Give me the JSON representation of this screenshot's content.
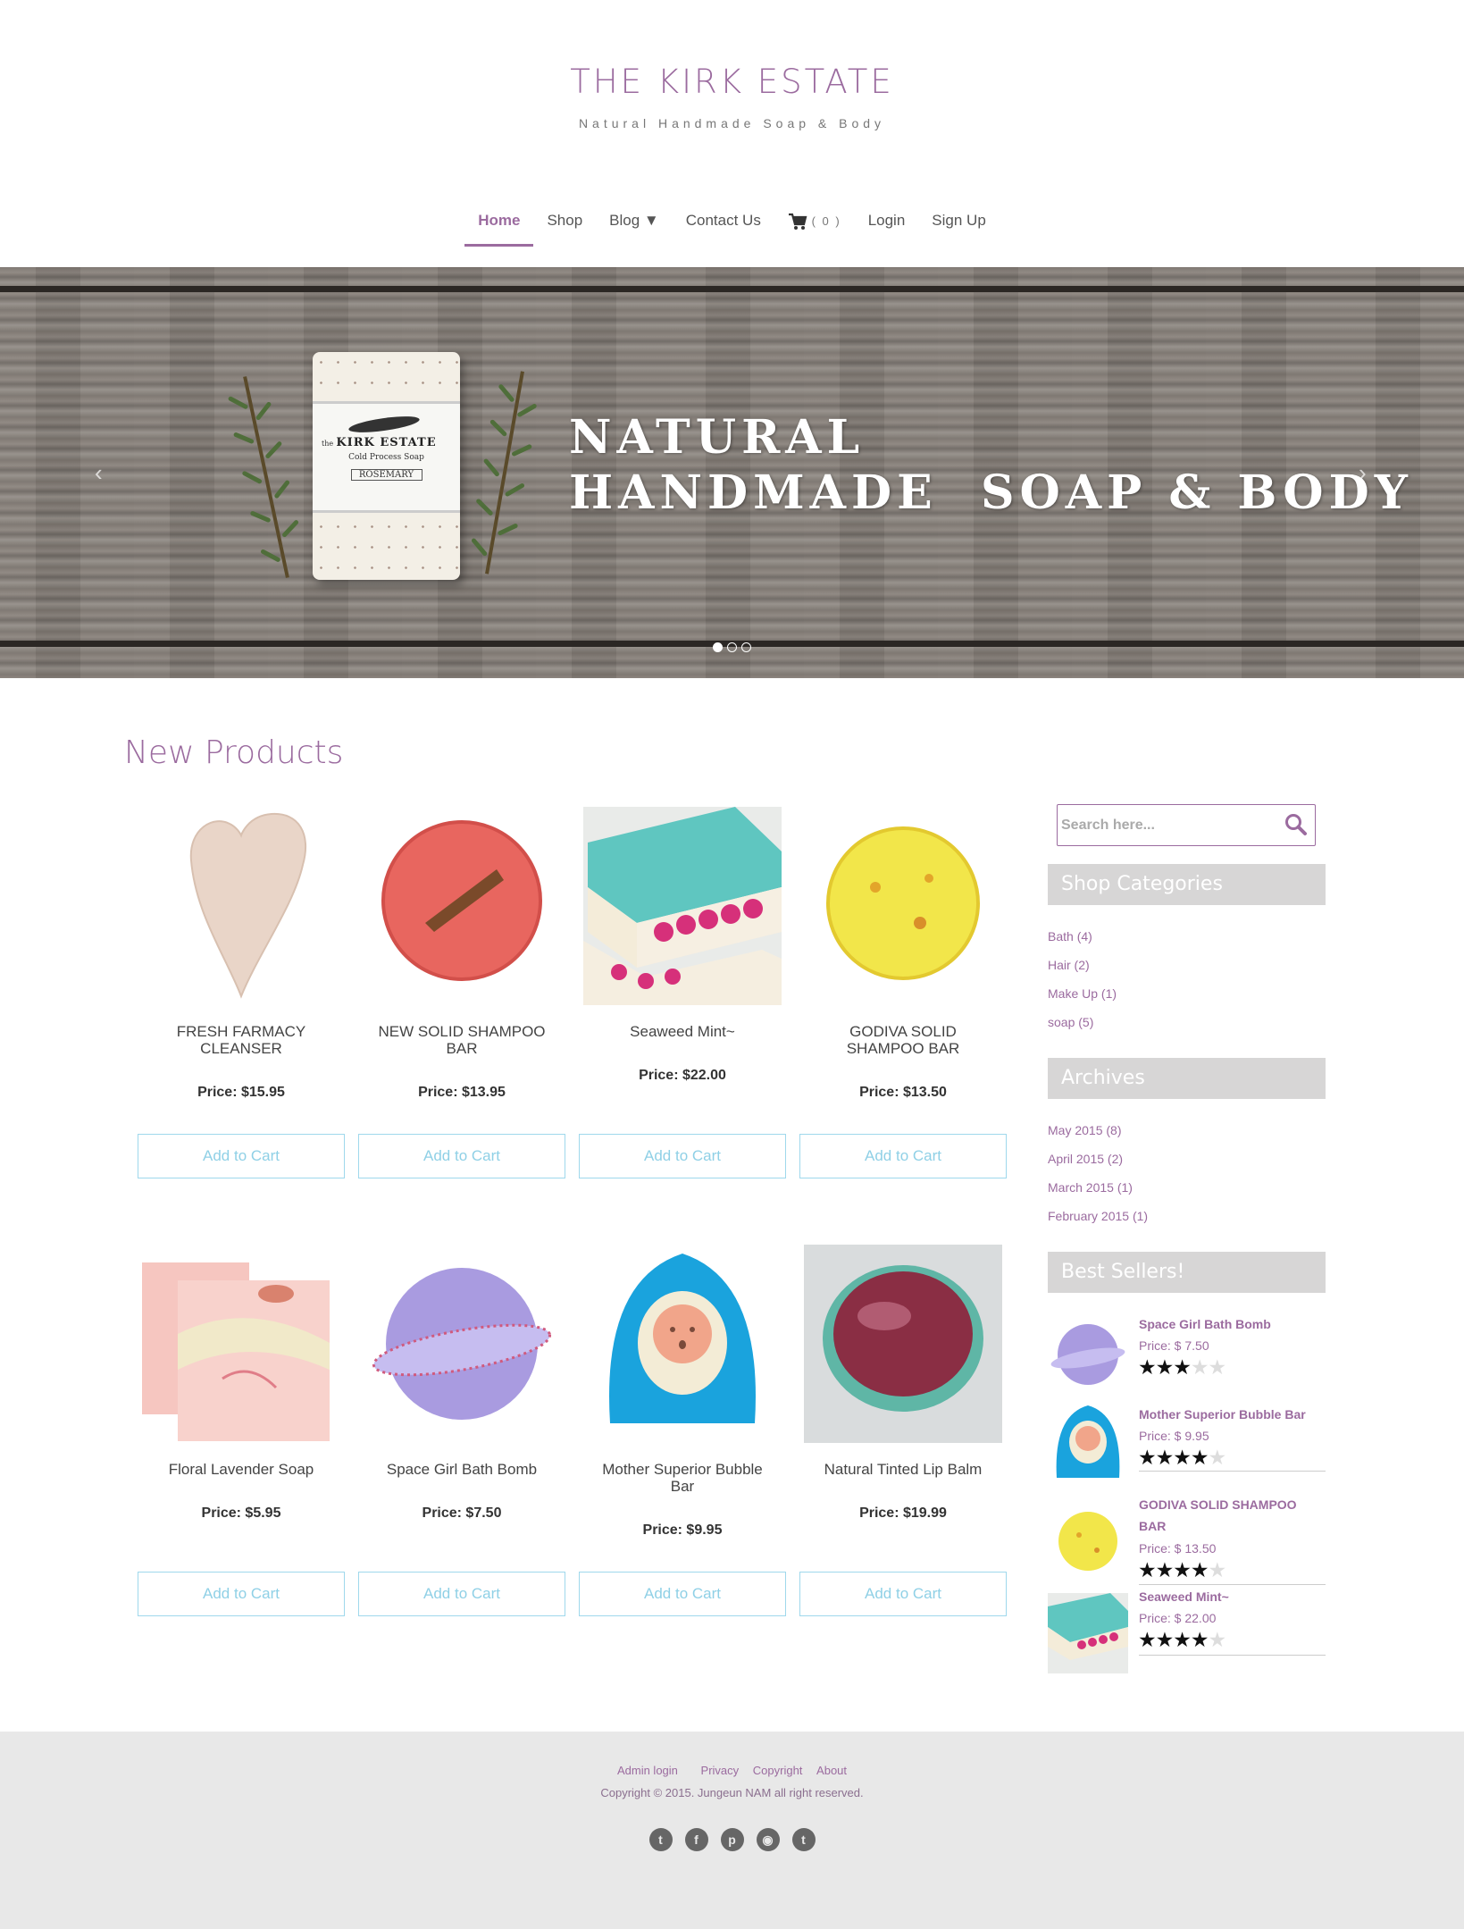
{
  "header": {
    "title": "THE KIRK ESTATE",
    "tagline": "Natural Handmade Soap & Body"
  },
  "nav": {
    "items": [
      {
        "label": "Home",
        "active": true
      },
      {
        "label": "Shop"
      },
      {
        "label": "Blog ▼"
      },
      {
        "label": "Contact Us"
      },
      {
        "label": "( 0 )",
        "icon": "cart-icon"
      },
      {
        "label": "Login"
      },
      {
        "label": "Sign Up"
      }
    ]
  },
  "hero": {
    "line1": "NATURAL",
    "line2": "HANDMADE  SOAP & BODY",
    "soap_brand": "KIRK ESTATE",
    "soap_small": "the",
    "soap_sub": "Cold Process Soap",
    "soap_name": "ROSEMARY",
    "prev_icon": "chevron-left-icon",
    "next_icon": "chevron-right-icon",
    "active_slide": 1,
    "slide_count": 3
  },
  "products_section": {
    "title": "New Products",
    "add_label": "Add to Cart",
    "items": [
      {
        "name": "FRESH FARMACY CLEANSER",
        "price": "Price: $15.95"
      },
      {
        "name": "NEW SOLID SHAMPOO BAR",
        "price": "Price: $13.95"
      },
      {
        "name": "Seaweed Mint~",
        "price": "Price: $22.00"
      },
      {
        "name": "GODIVA SOLID SHAMPOO BAR",
        "price": "Price: $13.50"
      },
      {
        "name": "Floral Lavender Soap",
        "price": "Price: $5.95"
      },
      {
        "name": "Space Girl Bath Bomb",
        "price": "Price: $7.50"
      },
      {
        "name": "Mother Superior Bubble Bar",
        "price": "Price: $9.95"
      },
      {
        "name": "Natural Tinted Lip Balm",
        "price": "Price: $19.99"
      }
    ]
  },
  "sidebar": {
    "search_placeholder": "Search here...",
    "categories_title": "Shop Categories",
    "categories": [
      "Bath (4)",
      "Hair (2)",
      "Make Up (1)",
      "soap (5)"
    ],
    "archives_title": "Archives",
    "archives": [
      "May 2015 (8)",
      "April 2015 (2)",
      "March 2015 (1)",
      "February 2015 (1)"
    ],
    "bestsellers_title": "Best Sellers!",
    "bestsellers": [
      {
        "name": "Space Girl Bath Bomb",
        "price": "Price: $ 7.50",
        "rating": 3
      },
      {
        "name": "Mother Superior Bubble Bar",
        "price": "Price: $ 9.95",
        "rating": 4
      },
      {
        "name": "GODIVA SOLID SHAMPOO BAR",
        "price": "Price: $ 13.50",
        "rating": 4
      },
      {
        "name": "Seaweed Mint~",
        "price": "Price: $ 22.00",
        "rating": 4
      }
    ]
  },
  "footer": {
    "links": [
      "Admin login",
      "Privacy",
      "Copyright",
      "About"
    ],
    "copyright": "Copyright © 2015. Jungeun NAM all right reserved.",
    "social": [
      "twitter-icon",
      "facebook-icon",
      "pinterest-icon",
      "rss-icon",
      "tumblr-icon"
    ]
  },
  "colors": {
    "accent": "#9b6b9f",
    "button_border": "#9fd8ec",
    "footer_bg": "#e8e8e8",
    "sidebar_head_bg": "#d7d6d6"
  }
}
